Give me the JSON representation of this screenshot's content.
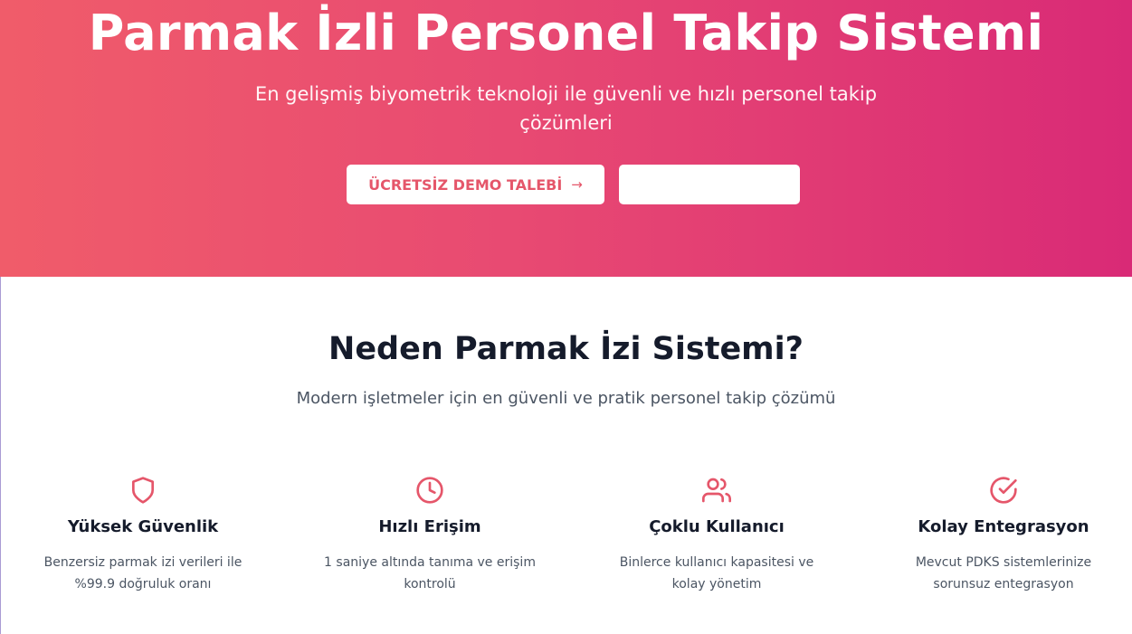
{
  "hero": {
    "title": "Parmak İzli Personel Takip Sistemi",
    "subtitle": "En gelişmiş biyometrik teknoloji ile güvenli ve hızlı personel takip çözümleri",
    "primary_button": "ÜCRETSİZ DEMO TALEBİ",
    "primary_button_arrow": "→",
    "secondary_button": ""
  },
  "why": {
    "title": "Neden Parmak İzi Sistemi?",
    "subtitle": "Modern işletmeler için en güvenli ve pratik personel takip çözümü"
  },
  "features": [
    {
      "icon": "shield-icon",
      "title": "Yüksek Güvenlik",
      "description": "Benzersiz parmak izi verileri ile %99.9 doğruluk oranı"
    },
    {
      "icon": "clock-icon",
      "title": "Hızlı Erişim",
      "description": "1 saniye altında tanıma ve erişim kontrolü"
    },
    {
      "icon": "users-icon",
      "title": "Çoklu Kullanıcı",
      "description": "Binlerce kullanıcı kapasitesi ve kolay yönetim"
    },
    {
      "icon": "check-circle-icon",
      "title": "Kolay Entegrasyon",
      "description": "Mevcut PDKS sistemlerinize sorunsuz entegrasyon"
    }
  ],
  "colors": {
    "gradient_start": "#f05c6a",
    "gradient_end": "#d92a76",
    "accent": "#e5566a",
    "heading": "#151b2b",
    "body_text": "#4b5563"
  }
}
